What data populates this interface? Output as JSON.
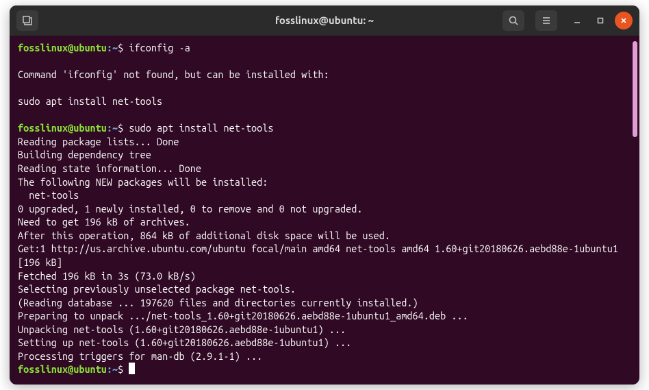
{
  "window": {
    "title": "fosslinux@ubuntu: ~"
  },
  "prompt": {
    "user_host": "fosslinux@ubuntu",
    "colon": ":",
    "path": "~",
    "dollar": "$"
  },
  "session": {
    "cmd1": "ifconfig -a",
    "out1_l1": "Command 'ifconfig' not found, but can be installed with:",
    "out1_l2": "sudo apt install net-tools",
    "cmd2": "sudo apt install net-tools",
    "out2": [
      "Reading package lists... Done",
      "Building dependency tree",
      "Reading state information... Done",
      "The following NEW packages will be installed:",
      "  net-tools",
      "0 upgraded, 1 newly installed, 0 to remove and 0 not upgraded.",
      "Need to get 196 kB of archives.",
      "After this operation, 864 kB of additional disk space will be used.",
      "Get:1 http://us.archive.ubuntu.com/ubuntu focal/main amd64 net-tools amd64 1.60+git20180626.aebd88e-1ubuntu1 [196 kB]",
      "Fetched 196 kB in 3s (73.0 kB/s)",
      "Selecting previously unselected package net-tools.",
      "(Reading database ... 197620 files and directories currently installed.)",
      "Preparing to unpack .../net-tools_1.60+git20180626.aebd88e-1ubuntu1_amd64.deb ...",
      "Unpacking net-tools (1.60+git20180626.aebd88e-1ubuntu1) ...",
      "Setting up net-tools (1.60+git20180626.aebd88e-1ubuntu1) ...",
      "Processing triggers for man-db (2.9.1-1) ..."
    ]
  }
}
